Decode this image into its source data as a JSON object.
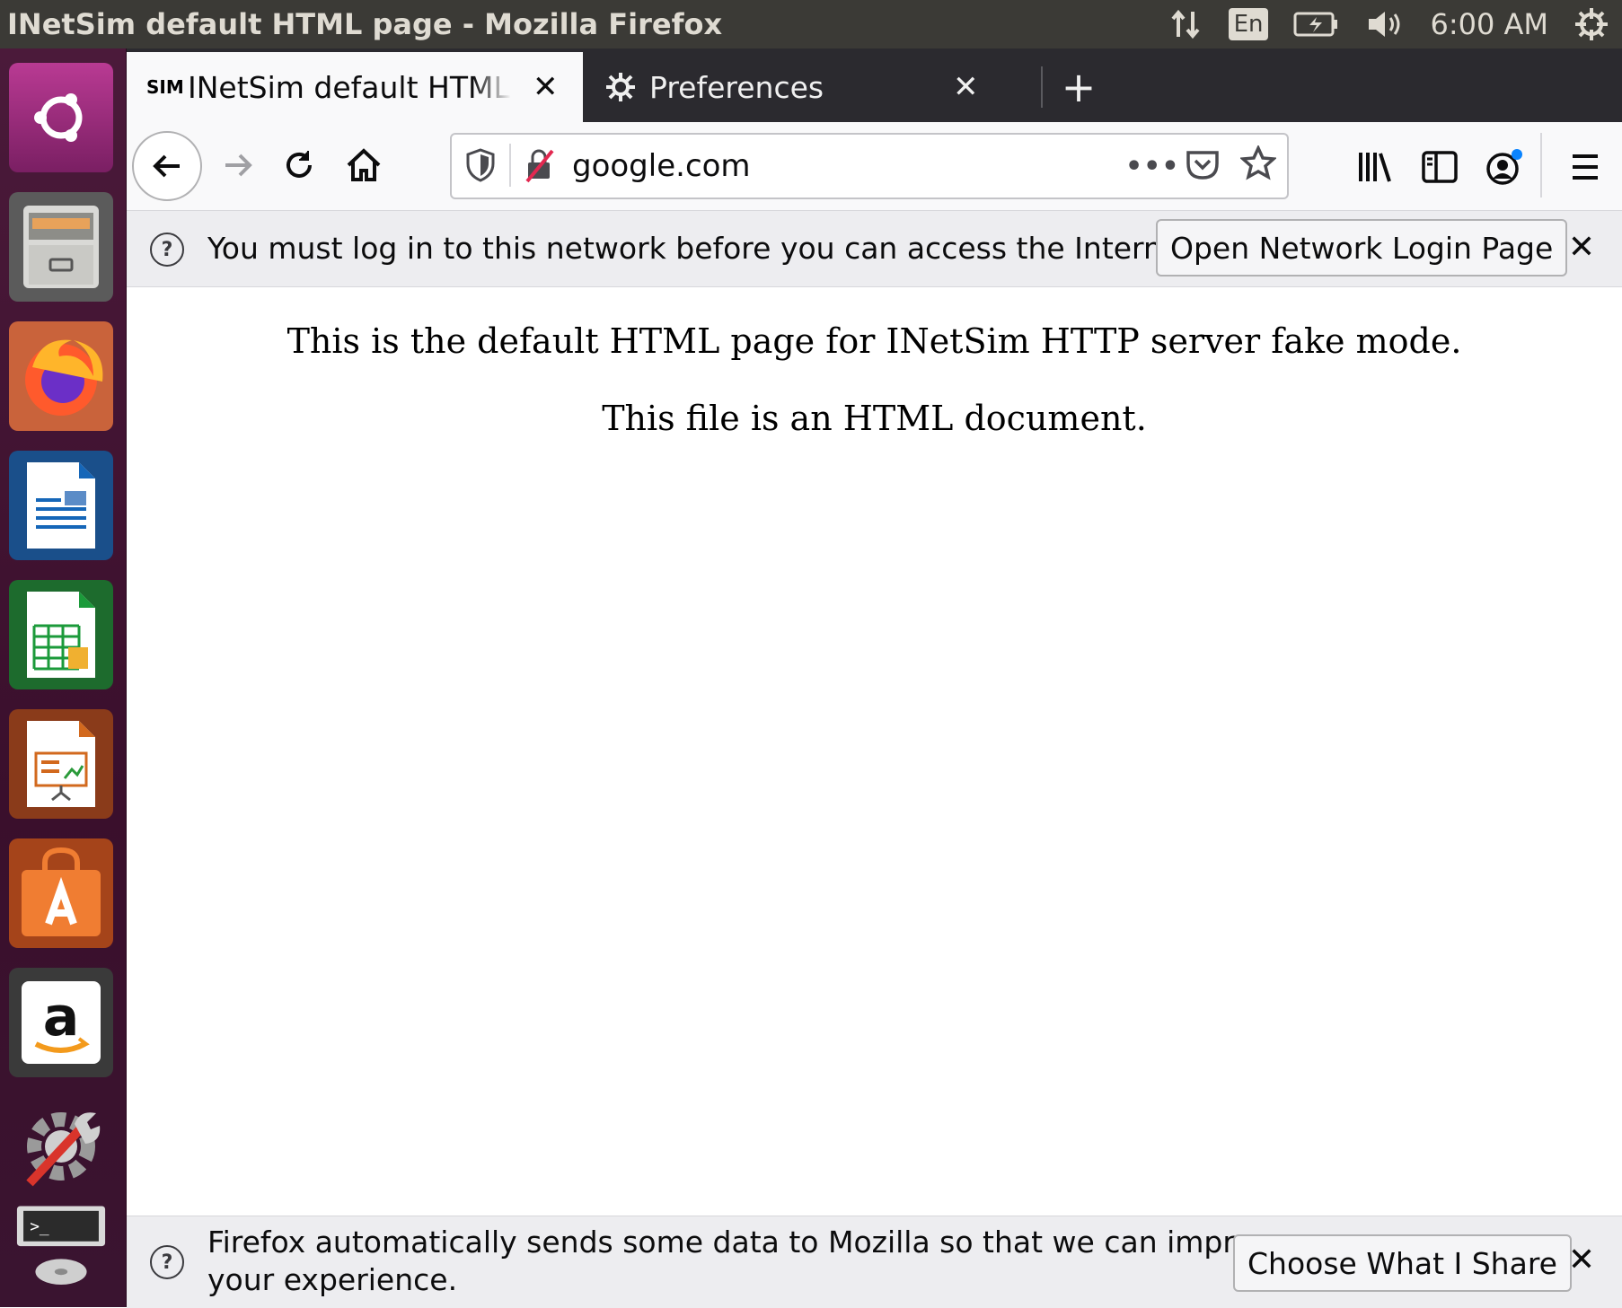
{
  "topbar": {
    "window_title": "INetSim default HTML page - Mozilla Firefox",
    "keyboard_layout": "En",
    "clock": "6:00 AM"
  },
  "launcher": {
    "items": [
      {
        "name": "ubuntu-dash"
      },
      {
        "name": "files"
      },
      {
        "name": "firefox"
      },
      {
        "name": "libreoffice-writer"
      },
      {
        "name": "libreoffice-calc"
      },
      {
        "name": "libreoffice-impress"
      },
      {
        "name": "ubuntu-software"
      },
      {
        "name": "amazon"
      },
      {
        "name": "system-settings"
      },
      {
        "name": "terminal"
      }
    ]
  },
  "tabs": [
    {
      "favicon": "SIM",
      "label": "INetSim default HTML page",
      "active": true
    },
    {
      "label": "Preferences",
      "active": false
    }
  ],
  "navbar": {
    "url": "google.com"
  },
  "network_notice": {
    "message": "You must log in to this network before you can access the Internet.",
    "button": "Open Network Login Page"
  },
  "page": {
    "line1": "This is the default HTML page for INetSim HTTP server fake mode.",
    "line2": "This file is an HTML document."
  },
  "data_notice": {
    "message_line1": "Firefox automatically sends some data to Mozilla so that we can improve",
    "message_line2": "your experience.",
    "button": "Choose What I Share"
  },
  "colors": {
    "top_panel": "#3b3a36",
    "launcher": "#3a0f2c",
    "tab_strip": "#2b2a2f",
    "toolbar": "#f9f9fa",
    "notification": "#ededf0"
  }
}
